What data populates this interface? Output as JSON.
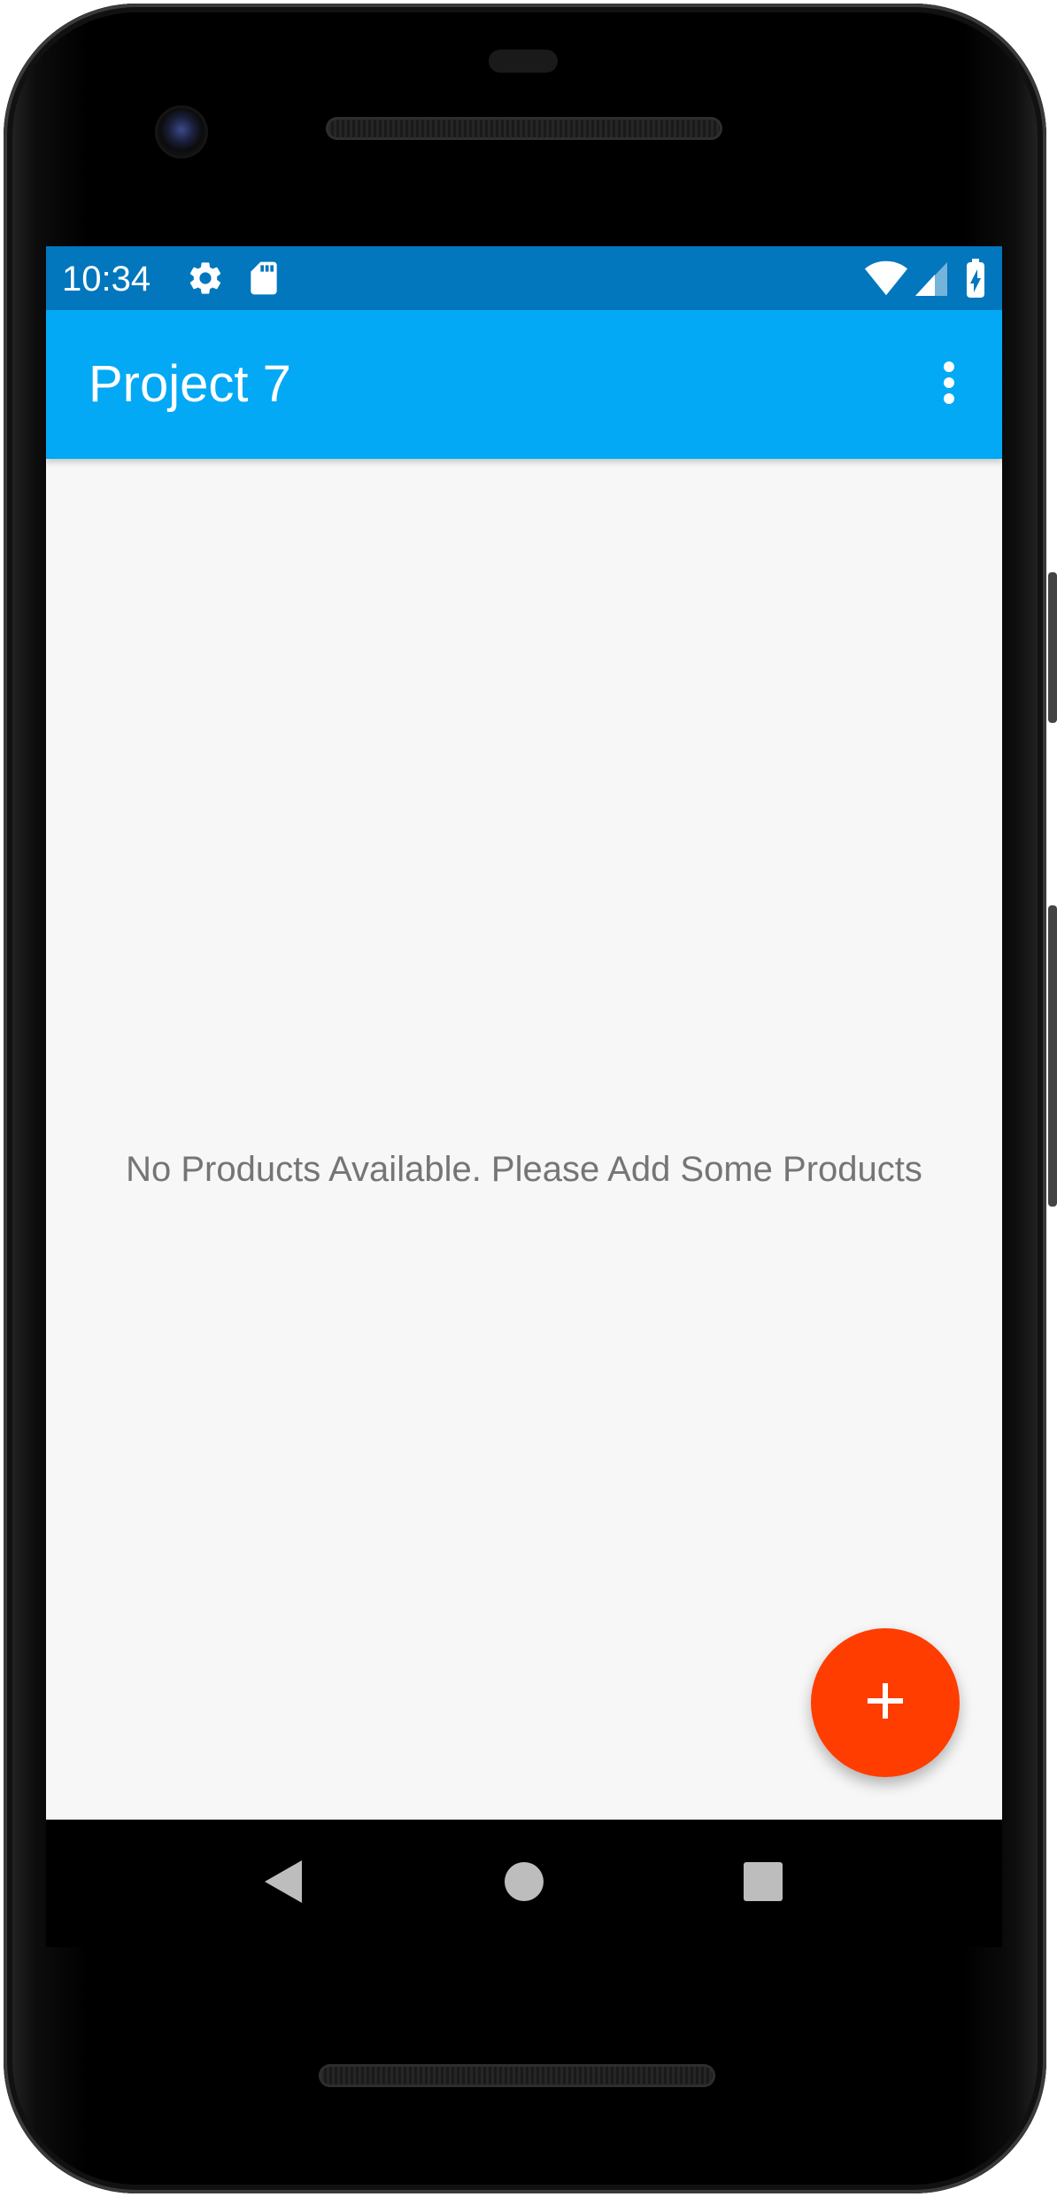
{
  "status_bar": {
    "time": "10:34",
    "icons": [
      "settings-icon",
      "sd-card-icon",
      "wifi-icon",
      "cell-signal-icon",
      "battery-charging-icon"
    ],
    "background": "#0277bd"
  },
  "app_bar": {
    "title": "Project 7",
    "background": "#03a9f4",
    "menu_icon": "more-vert-icon"
  },
  "main": {
    "empty_message": "No Products Available. Please Add Some Products",
    "background": "#f7f7f7"
  },
  "fab": {
    "icon": "add-icon",
    "background": "#ff3d00"
  },
  "nav_bar": {
    "buttons": [
      "back-icon",
      "home-icon",
      "recents-icon"
    ]
  }
}
